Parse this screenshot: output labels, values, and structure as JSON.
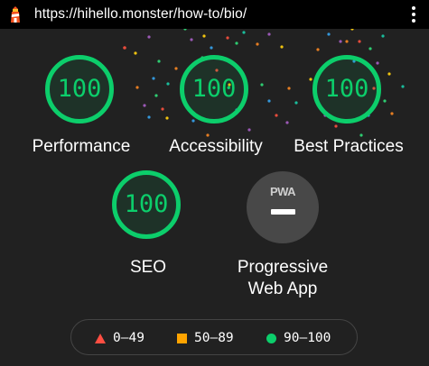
{
  "browser": {
    "url": "https://hihello.monster/how-to/bio/",
    "page_icon": "lighthouse-icon",
    "menu_icon": "more-vert-icon"
  },
  "colors": {
    "background": "#212121",
    "pass": "#0cce6b",
    "average": "#ffa400",
    "fail": "#ff4e42"
  },
  "scores": [
    {
      "label": "Performance",
      "value": "100"
    },
    {
      "label": "Accessibility",
      "value": "100"
    },
    {
      "label": "Best Practices",
      "value": "100"
    },
    {
      "label": "SEO",
      "value": "100"
    }
  ],
  "pwa": {
    "badge_text": "PWA",
    "label_line1": "Progressive",
    "label_line2": "Web App"
  },
  "legend": [
    {
      "icon": "triangle-icon",
      "range": "0–49"
    },
    {
      "icon": "square-icon",
      "range": "50–89"
    },
    {
      "icon": "circle-icon",
      "range": "90–100"
    }
  ]
}
